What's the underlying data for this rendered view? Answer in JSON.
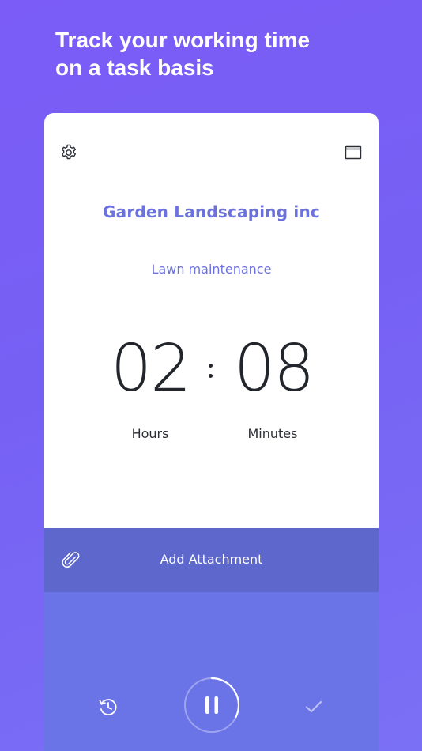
{
  "headline": {
    "line1": "Track your working time",
    "line2": "on a task basis"
  },
  "timer": {
    "client": "Garden Landscaping inc",
    "task": "Lawn maintenance",
    "hours": "02",
    "minutes": "08",
    "hours_label": "Hours",
    "minutes_label": "Minutes"
  },
  "attachment": {
    "label": "Add Attachment"
  },
  "icons": {
    "settings": "gear-icon",
    "window": "window-icon",
    "attachment": "paperclip-icon",
    "history": "history-icon",
    "pause": "pause-icon",
    "done": "checkmark-icon"
  },
  "colors": {
    "background": "#7760f5",
    "accent_text": "#6c72dc",
    "attach_bar": "#5d67cc",
    "controls_panel": "#6a74e6"
  }
}
